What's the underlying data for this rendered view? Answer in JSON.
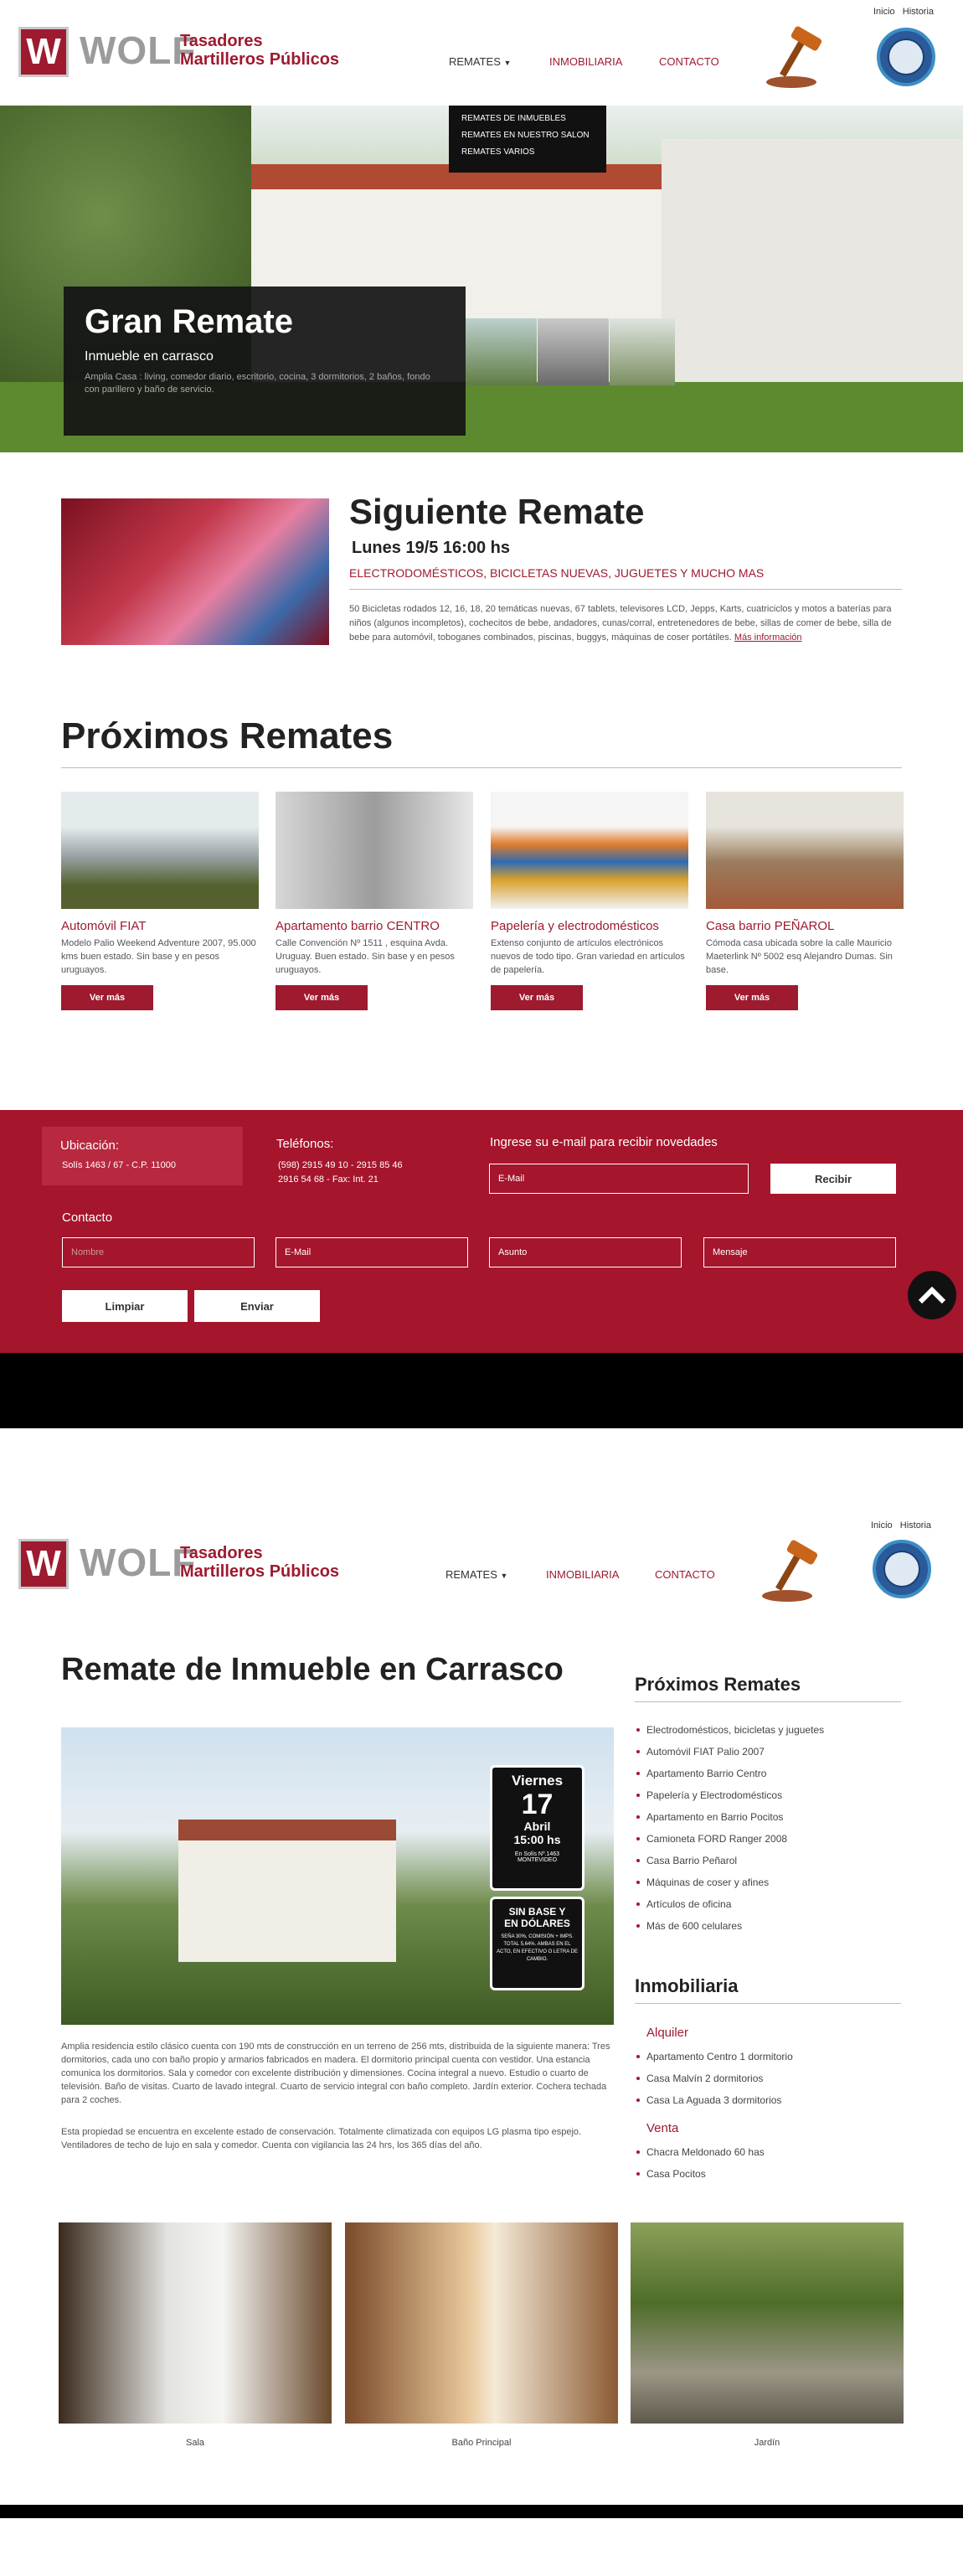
{
  "header1": {
    "logo_letter": "W",
    "brand": "WOLF",
    "tagline_1": "Tasadores",
    "tagline_2": "Martilleros Públicos",
    "top_links": [
      "Inicio",
      "Historia"
    ],
    "nav": {
      "remates": "REMATES",
      "inmobiliaria": "INMOBILIARIA",
      "contacto": "CONTACTO"
    },
    "dropdown": [
      "REMATES DE INMUEBLES",
      "REMATES EN NUESTRO SALON",
      "REMATES VARIOS"
    ]
  },
  "hero": {
    "title": "Gran Remate",
    "subtitle": "Inmueble en carrasco",
    "description": "Amplia Casa : living, comedor diario, escritorio, cocina, 3 dormitorios, 2 baños, fondo con parillero y baño de servicio."
  },
  "next": {
    "title": "Siguiente Remate",
    "date": "Lunes 19/5 16:00 hs",
    "headline": "ELECTRODOMÉSTICOS, BICICLETAS NUEVAS, JUGUETES Y MUCHO MAS",
    "description": "50 Bicicletas rodados 12, 16, 18, 20 temáticas nuevas, 67 tablets, televisores LCD, Jepps, Karts, cuatriciclos y motos a baterías para niños (algunos incompletos), cochecitos de bebe, andadores, cunas/corral, entretenedores de bebe, sillas de comer de bebe, silla de bebe para automóvil, toboganes combinados, piscinas, buggys, máquinas de coser portátiles.",
    "more_link": "Más información"
  },
  "upcoming": {
    "title": "Próximos Remates",
    "items": [
      {
        "title": "Automóvil FIAT",
        "text": "Modelo Palio Weekend Adventure 2007, 95.000 kms buen estado. Sin base y en pesos uruguayos.",
        "button": "Ver más"
      },
      {
        "title": "Apartamento barrio CENTRO",
        "text": "Calle Convención Nº 1511 , esquina Avda. Uruguay. Buen estado. Sin base y en pesos uruguayos.",
        "button": "Ver más"
      },
      {
        "title": "Papelería y electrodomésticos",
        "text": "Extenso conjunto de artículos electrónicos nuevos de todo tipo. Gran variedad en artículos de papelería.",
        "button": "Ver más"
      },
      {
        "title": "Casa barrio PEÑAROL",
        "text": "Cómoda casa ubicada sobre la calle Mauricio Maeterlink Nº 5002 esq Alejandro Dumas. Sin base.",
        "button": "Ver más"
      }
    ]
  },
  "footer": {
    "location_label": "Ubicación:",
    "address": "Solís 1463 / 67 - C.P. 11000",
    "phone_label": "Teléfonos:",
    "phone_1": "(598) 2915 49 10 - 2915 85 46",
    "phone_2": "2916 54 68  -  Fax: Int. 21",
    "newsletter_label": "Ingrese su e-mail para recibir novedades",
    "newsletter_placeholder": "E-Mail",
    "subscribe_button": "Recibir",
    "contact_label": "Contacto",
    "placeholders": {
      "name": "Nombre",
      "email": "E-Mail",
      "subject": "Asunto",
      "message": "Mensaje"
    },
    "clear_button": "Limpiar",
    "send_button": "Enviar"
  },
  "page2": {
    "title": "Remate de Inmueble en Carrasco",
    "badge": {
      "day_name": "Viernes",
      "day": "17",
      "month": "Abril",
      "time": "15:00 hs",
      "place_1": "En Solís Nº.1463",
      "place_2": "MONTEVIDEO"
    },
    "badge2": {
      "line1": "SIN BASE Y",
      "line2": "EN DÓLARES",
      "small": "SEÑA 30%, COMISIÓN + IMPS. TOTAL 5,64%. AMBAS EN EL ACTO, EN EFECTIVO O LETRA DE CAMBIO."
    },
    "para1": "Amplia residencia estilo clásico cuenta con 190 mts de construcción en un terreno de 256 mts, distribuida de la siguiente manera: Tres dormitorios, cada uno con baño propio y armarios fabricados en madera. El dormitorio principal cuenta con vestidor. Una estancia comunica los dormitorios. Sala y comedor con excelente distribución y dimensiones. Cocina integral a nuevo. Estudio o cuarto de televisión. Baño de visitas. Cuarto de lavado integral. Cuarto de servicio integral con baño completo. Jardín exterior. Cochera techada para 2 coches.",
    "para2": "Esta propiedad se encuentra en excelente estado de conservación. Totalmente climatizada con equipos LG plasma tipo espejo. Ventiladores de techo de lujo en sala y comedor. Cuenta con vigilancia las 24 hrs, los 365 días del año.",
    "sidebar_title": "Próximos Remates",
    "sidebar_items": [
      "Electrodomésticos, bicicletas y juguetes",
      "Automóvil FIAT Palio 2007",
      "Apartamento Barrio Centro",
      "Papelería y Electrodomésticos",
      "Apartamento en Barrio Pocitos",
      "Camioneta FORD Ranger 2008",
      "Casa Barrio Peñarol",
      "Máquinas de coser y afines",
      "Artículos de oficina",
      "Más de 600 celulares"
    ],
    "inmob_title": "Inmobiliaria",
    "alquiler_label": "Alquiler",
    "alquiler_items": [
      "Apartamento Centro 1 dormitorio",
      "Casa Malvín 2 dormitorios",
      "Casa La Aguada 3 dormitorios"
    ],
    "venta_label": "Venta",
    "venta_items": [
      "Chacra Meldonado 60 has",
      "Casa Pocitos"
    ],
    "gallery": [
      "Sala",
      "Baño Principal",
      "Jardín"
    ]
  }
}
